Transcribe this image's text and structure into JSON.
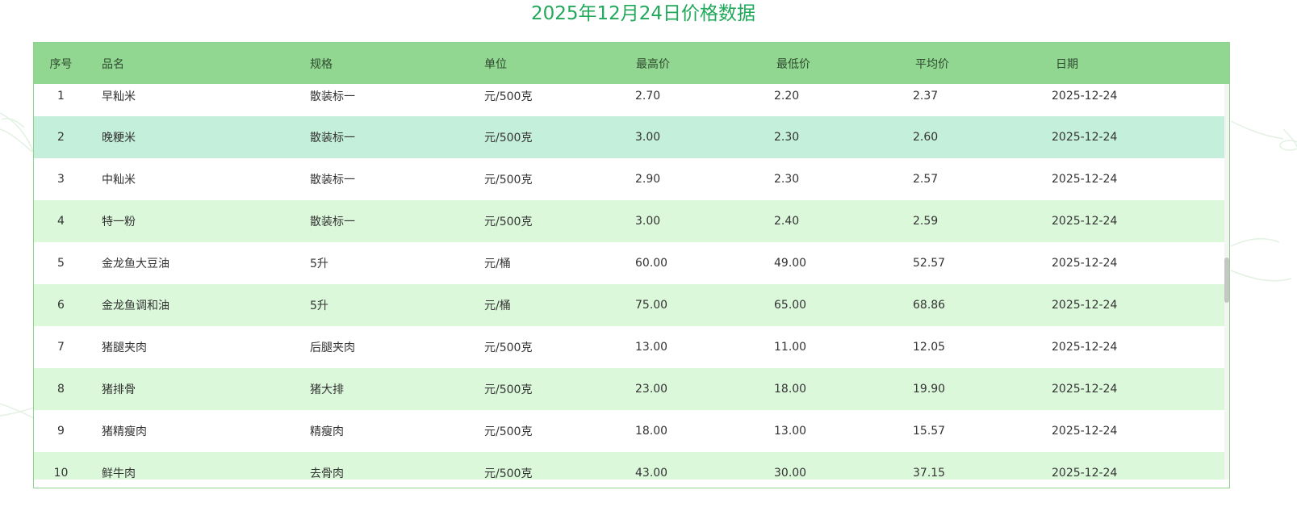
{
  "title": "2025年12月24日价格数据",
  "colors": {
    "title": "#22a85a",
    "header_bg": "#92d791",
    "row_highlight": "#c4efdb",
    "row_alt": "#dcf8db",
    "row_plain": "#ffffff"
  },
  "table": {
    "headers": [
      "序号",
      "品名",
      "规格",
      "单位",
      "最高价",
      "最低价",
      "平均价",
      "日期"
    ],
    "rows": [
      {
        "no": "1",
        "name": "早籼米",
        "spec": "散装标一",
        "unit": "元/500克",
        "max": "2.70",
        "min": "2.20",
        "avg": "2.37",
        "date": "2025-12-24"
      },
      {
        "no": "2",
        "name": "晚粳米",
        "spec": "散装标一",
        "unit": "元/500克",
        "max": "3.00",
        "min": "2.30",
        "avg": "2.60",
        "date": "2025-12-24"
      },
      {
        "no": "3",
        "name": "中籼米",
        "spec": "散装标一",
        "unit": "元/500克",
        "max": "2.90",
        "min": "2.30",
        "avg": "2.57",
        "date": "2025-12-24"
      },
      {
        "no": "4",
        "name": "特一粉",
        "spec": "散装标一",
        "unit": "元/500克",
        "max": "3.00",
        "min": "2.40",
        "avg": "2.59",
        "date": "2025-12-24"
      },
      {
        "no": "5",
        "name": "金龙鱼大豆油",
        "spec": "5升",
        "unit": "元/桶",
        "max": "60.00",
        "min": "49.00",
        "avg": "52.57",
        "date": "2025-12-24"
      },
      {
        "no": "6",
        "name": "金龙鱼调和油",
        "spec": "5升",
        "unit": "元/桶",
        "max": "75.00",
        "min": "65.00",
        "avg": "68.86",
        "date": "2025-12-24"
      },
      {
        "no": "7",
        "name": "猪腿夹肉",
        "spec": "后腿夹肉",
        "unit": "元/500克",
        "max": "13.00",
        "min": "11.00",
        "avg": "12.05",
        "date": "2025-12-24"
      },
      {
        "no": "8",
        "name": "猪排骨",
        "spec": "猪大排",
        "unit": "元/500克",
        "max": "23.00",
        "min": "18.00",
        "avg": "19.90",
        "date": "2025-12-24"
      },
      {
        "no": "9",
        "name": "猪精瘦肉",
        "spec": "精瘦肉",
        "unit": "元/500克",
        "max": "18.00",
        "min": "13.00",
        "avg": "15.57",
        "date": "2025-12-24"
      },
      {
        "no": "10",
        "name": "鲜牛肉",
        "spec": "去骨肉",
        "unit": "元/500克",
        "max": "43.00",
        "min": "30.00",
        "avg": "37.15",
        "date": "2025-12-24"
      }
    ]
  }
}
